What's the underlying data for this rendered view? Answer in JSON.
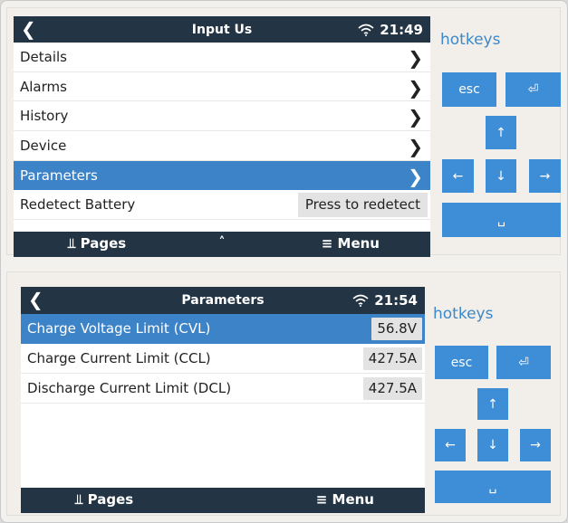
{
  "colors": {
    "header_bg": "#233445",
    "accent": "#3d83c7",
    "hotkey_blue": "#3d8ed6"
  },
  "screen1": {
    "title": "Input Us",
    "time": "21:49",
    "rows": [
      {
        "label": "Details"
      },
      {
        "label": "Alarms"
      },
      {
        "label": "History"
      },
      {
        "label": "Device"
      },
      {
        "label": "Parameters",
        "selected": true
      }
    ],
    "redetect_label": "Redetect Battery",
    "redetect_button": "Press to redetect",
    "footer": {
      "pages": "Pages",
      "menu": "Menu"
    }
  },
  "screen2": {
    "title": "Parameters",
    "time": "21:54",
    "rows": [
      {
        "label": "Charge Voltage Limit (CVL)",
        "value": "56.8V",
        "selected": true
      },
      {
        "label": "Charge Current Limit (CCL)",
        "value": "427.5A"
      },
      {
        "label": "Discharge Current Limit (DCL)",
        "value": "427.5A"
      }
    ],
    "footer": {
      "pages": "Pages",
      "menu": "Menu"
    }
  },
  "hotkeys": {
    "label": "hotkeys",
    "esc": "esc"
  },
  "icons": [
    "back-chevron-icon",
    "wifi-icon",
    "chevron-right-icon",
    "pages-icon",
    "chevron-up-icon",
    "menu-icon",
    "enter-icon",
    "arrow-up-icon",
    "arrow-down-icon",
    "arrow-left-icon",
    "arrow-right-icon",
    "space-icon"
  ]
}
